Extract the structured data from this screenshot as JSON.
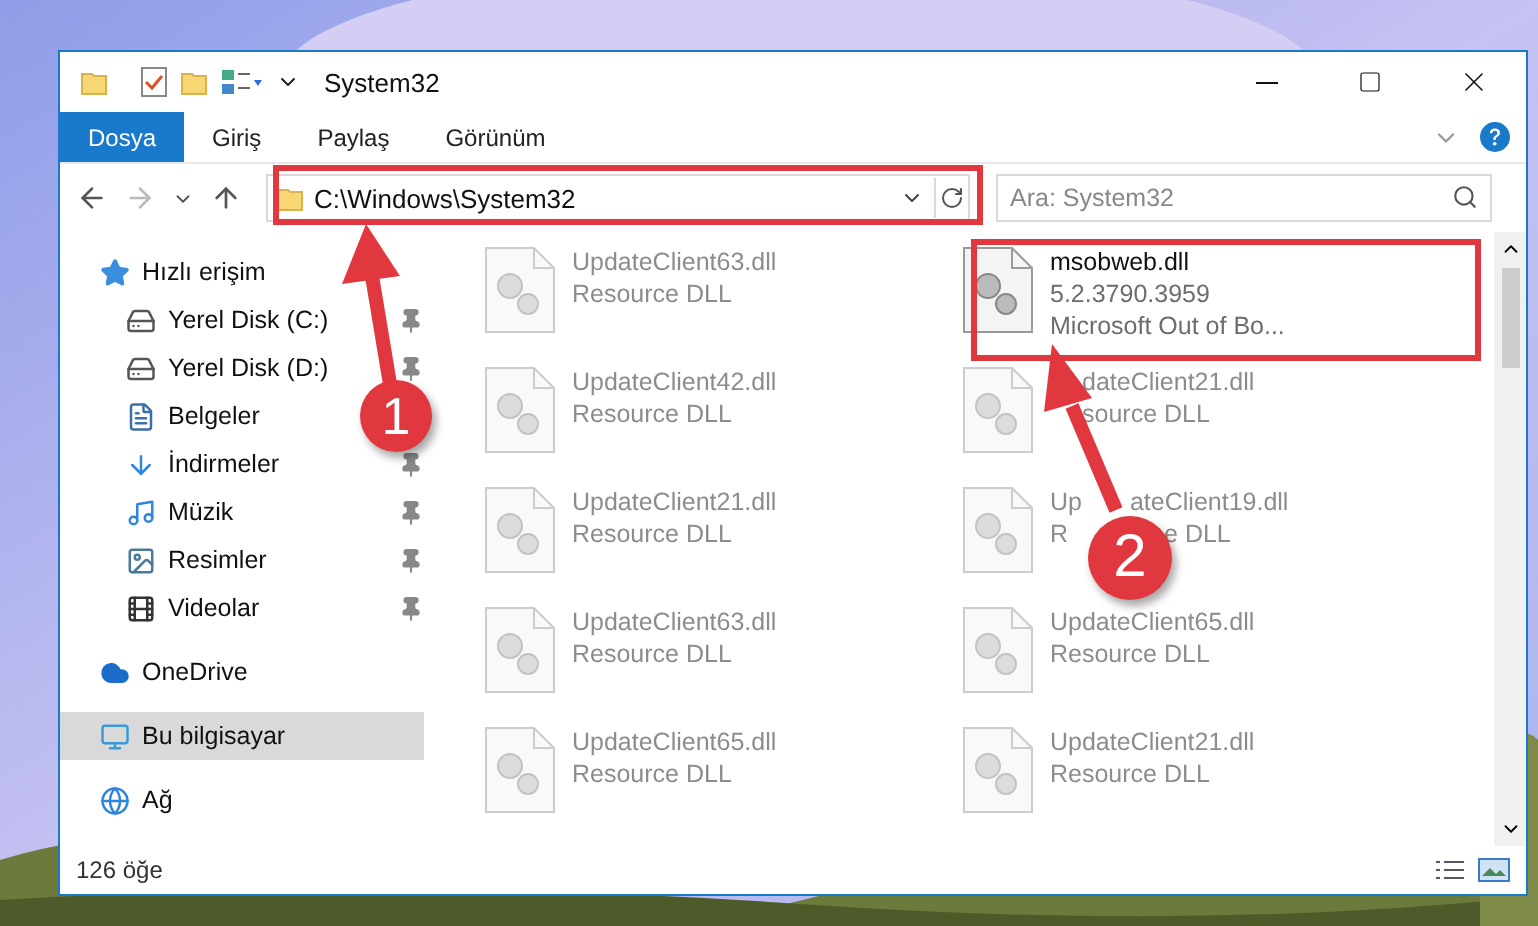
{
  "window": {
    "title": "System32"
  },
  "ribbon_tabs": [
    {
      "label": "Dosya",
      "selected": true
    },
    {
      "label": "Giriş",
      "selected": false
    },
    {
      "label": "Paylaş",
      "selected": false
    },
    {
      "label": "Görünüm",
      "selected": false
    }
  ],
  "address": {
    "value": "C:\\Windows\\System32"
  },
  "search": {
    "placeholder": "Ara: System32"
  },
  "sidebar": {
    "items": [
      {
        "label": "Hızlı erişim",
        "selected": false,
        "children": [
          {
            "label": "Yerel Disk (C:)",
            "pinned": true,
            "selected": false
          },
          {
            "label": "Yerel Disk (D:)",
            "pinned": true,
            "selected": false
          },
          {
            "label": "Belgeler",
            "selected": false
          },
          {
            "label": "İndirmeler",
            "pinned": true,
            "selected": false
          },
          {
            "label": "Müzik",
            "pinned": true,
            "selected": false
          },
          {
            "label": "Resimler",
            "pinned": true,
            "selected": false
          },
          {
            "label": "Videolar",
            "pinned": true,
            "selected": false
          }
        ]
      },
      {
        "label": "OneDrive",
        "selected": false
      },
      {
        "label": "Bu bilgisayar",
        "selected": true
      },
      {
        "label": "Ağ",
        "selected": false
      }
    ]
  },
  "files": [
    {
      "kind": "plain",
      "name": "UpdateClient63.dll",
      "lines": [
        "Resource DLL"
      ],
      "faded": true
    },
    {
      "kind": "plain",
      "name": "msobweb.dll",
      "lines": [
        "5.2.3790.3959",
        "Microsoft Out of Bo..."
      ],
      "faded": false
    },
    {
      "kind": "plain",
      "name": "UpdateClient42.dll",
      "lines": [
        "Resource DLL"
      ],
      "faded": true
    },
    {
      "kind": "indented",
      "name": "dateClient21.dll",
      "lines": [
        "source DLL"
      ],
      "faded": true
    },
    {
      "kind": "plain",
      "name": "UpdateClient21.dll",
      "lines": [
        "Resource DLL"
      ],
      "faded": true
    },
    {
      "kind": "split",
      "name_start": "Up",
      "name": "ateClient19.dll",
      "line_start": "R",
      "lines": [
        "e DLL"
      ],
      "faded": true
    },
    {
      "kind": "plain",
      "name": "UpdateClient63.dll",
      "lines": [
        "Resource DLL"
      ],
      "faded": true
    },
    {
      "kind": "plain",
      "name": "UpdateClient65.dll",
      "lines": [
        "Resource DLL"
      ],
      "faded": true
    },
    {
      "kind": "plain",
      "name": "UpdateClient65.dll",
      "lines": [
        "Resource DLL"
      ],
      "faded": true
    },
    {
      "kind": "plain",
      "name": "UpdateClient21.dll",
      "lines": [
        "Resource DLL"
      ],
      "faded": true
    }
  ],
  "status_bar": {
    "count": "126 öğe"
  },
  "annotations": [
    {
      "number": "1"
    },
    {
      "number": "2"
    }
  ]
}
